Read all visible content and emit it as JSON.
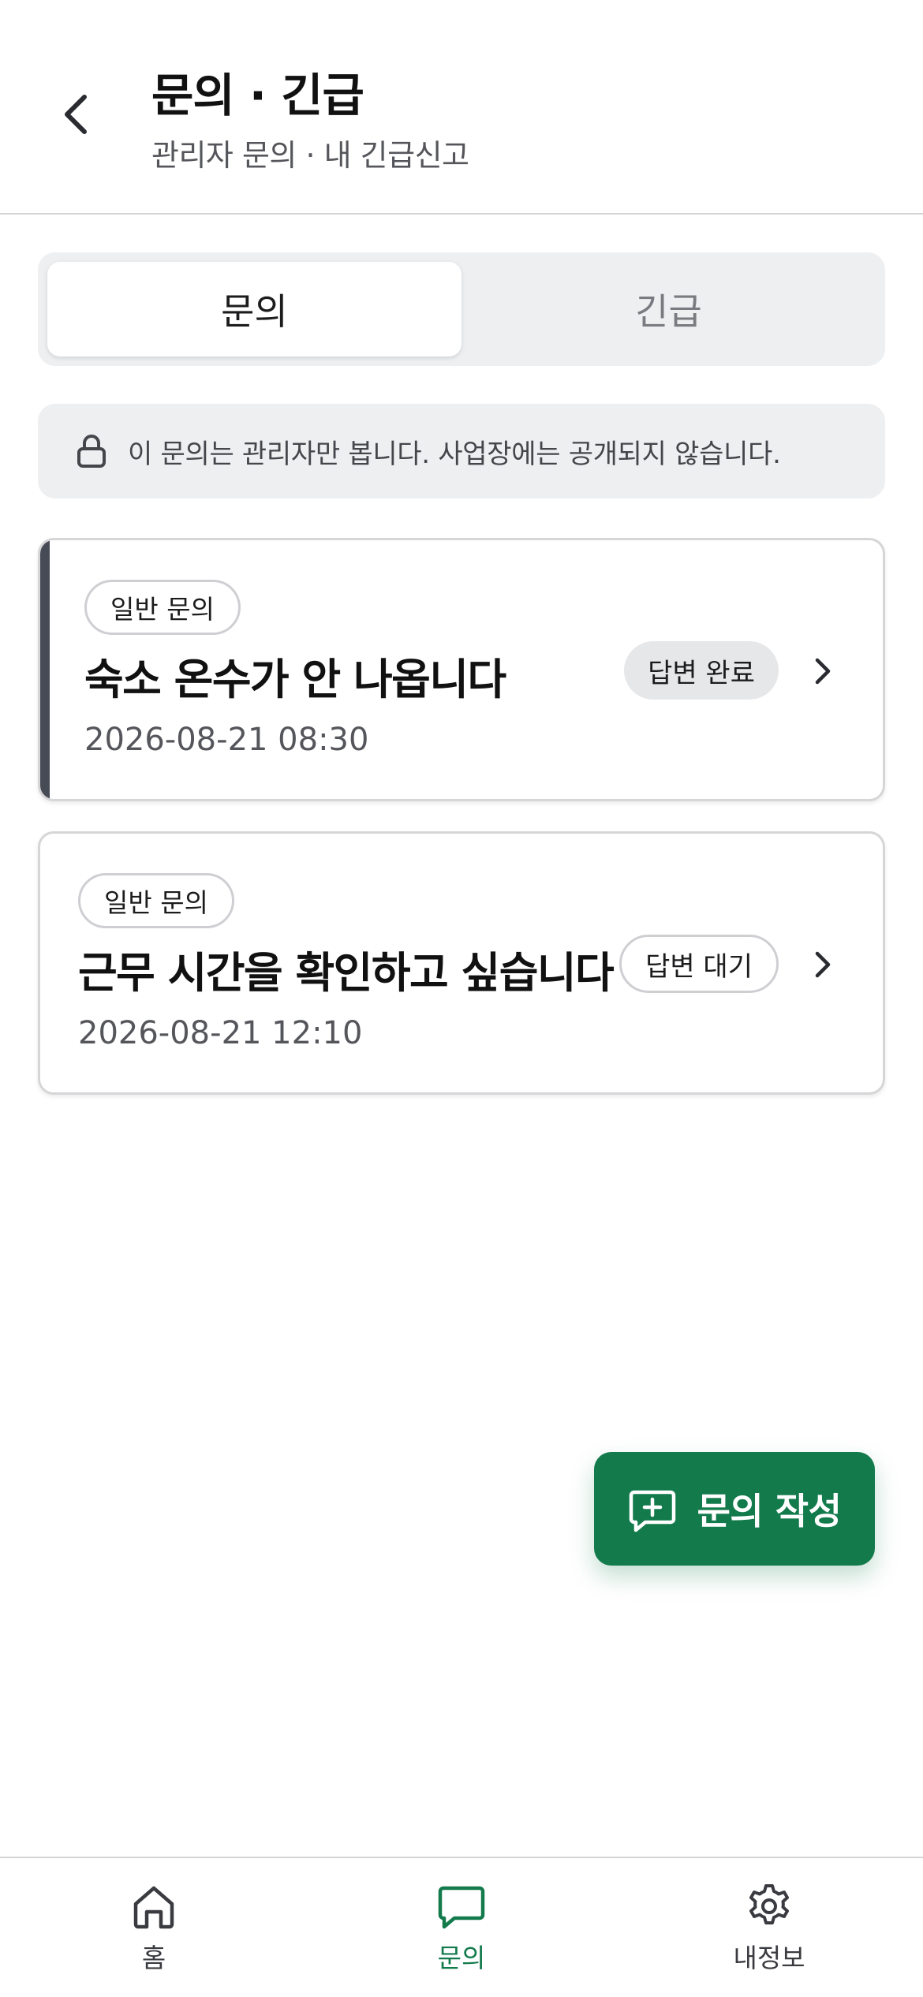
{
  "header": {
    "title": "문의 · 긴급",
    "subtitle": "관리자 문의 · 내 긴급신고"
  },
  "tabs": [
    {
      "label": "문의",
      "active": true
    },
    {
      "label": "긴급",
      "active": false
    }
  ],
  "notice": {
    "icon": "lock-icon",
    "text": "이 문의는 관리자만 봅니다. 사업장에는 공개되지 않습니다."
  },
  "inquiries": [
    {
      "category": "일반 문의",
      "title": "숙소 온수가 안 나옵니다",
      "date": "2026-08-21 08:30",
      "status": "답변 완료"
    },
    {
      "category": "일반 문의",
      "title": "근무 시간을 확인하고 싶습니다",
      "date": "2026-08-21 12:10",
      "status": "답변 대기"
    }
  ],
  "fab": {
    "label": "문의 작성",
    "icon": "message-plus-icon"
  },
  "bottom_nav": [
    {
      "label": "홈",
      "icon": "home-icon"
    },
    {
      "label": "문의",
      "icon": "chat-icon",
      "active": true
    },
    {
      "label": "내정보",
      "icon": "gear-icon"
    }
  ],
  "colors": {
    "accent": "#137a4c",
    "selected_bar": "#474b55",
    "surface_muted": "#eeeff1"
  }
}
